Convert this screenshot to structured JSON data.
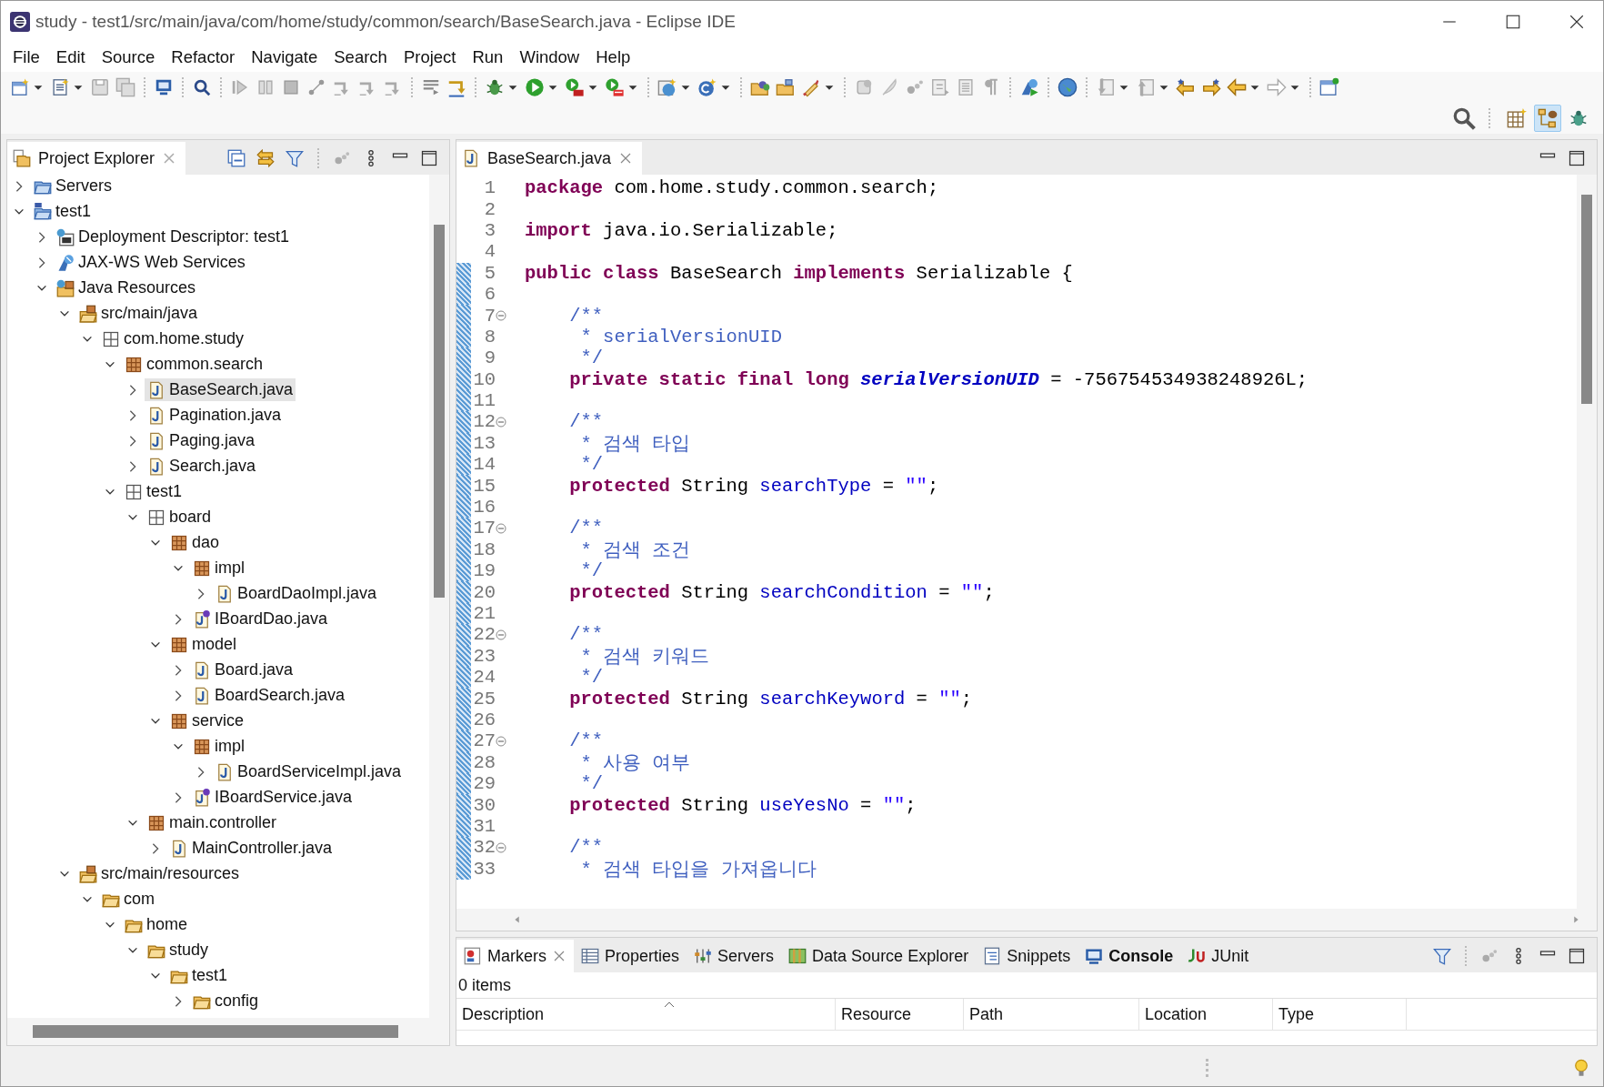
{
  "window": {
    "title": "study - test1/src/main/java/com/home/study/common/search/BaseSearch.java - Eclipse IDE"
  },
  "menu": [
    "File",
    "Edit",
    "Source",
    "Refactor",
    "Navigate",
    "Search",
    "Project",
    "Run",
    "Window",
    "Help"
  ],
  "perspectives": [
    {
      "selected": false
    },
    {
      "selected": true
    },
    {
      "selected": false
    }
  ],
  "explorer": {
    "title": "Project Explorer",
    "tree": [
      {
        "label": "Servers",
        "kind": "servers",
        "expanded": false,
        "selected": false
      },
      {
        "label": "test1",
        "kind": "project",
        "expanded": true,
        "selected": false,
        "children": [
          {
            "label": "Deployment Descriptor: test1",
            "kind": "descriptor",
            "expanded": false,
            "selected": false
          },
          {
            "label": "JAX-WS Web Services",
            "kind": "webservices",
            "expanded": false,
            "selected": false
          },
          {
            "label": "Java Resources",
            "kind": "javares",
            "expanded": true,
            "selected": false,
            "children": [
              {
                "label": "src/main/java",
                "kind": "srcfolder",
                "expanded": true,
                "selected": false,
                "children": [
                  {
                    "label": "com.home.study",
                    "kind": "emptypackage",
                    "expanded": true,
                    "selected": false,
                    "children": [
                      {
                        "label": "common.search",
                        "kind": "package",
                        "expanded": true,
                        "selected": false,
                        "children": [
                          {
                            "label": "BaseSearch.java",
                            "kind": "java",
                            "expanded": false,
                            "selected": true
                          },
                          {
                            "label": "Pagination.java",
                            "kind": "java",
                            "expanded": false,
                            "selected": false
                          },
                          {
                            "label": "Paging.java",
                            "kind": "java",
                            "expanded": false,
                            "selected": false
                          },
                          {
                            "label": "Search.java",
                            "kind": "java",
                            "expanded": false,
                            "selected": false
                          }
                        ]
                      },
                      {
                        "label": "test1",
                        "kind": "emptypackage",
                        "expanded": true,
                        "selected": false,
                        "children": [
                          {
                            "label": "board",
                            "kind": "emptypackage",
                            "expanded": true,
                            "selected": false,
                            "children": [
                              {
                                "label": "dao",
                                "kind": "package",
                                "expanded": true,
                                "selected": false,
                                "children": [
                                  {
                                    "label": "impl",
                                    "kind": "package",
                                    "expanded": true,
                                    "selected": false,
                                    "children": [
                                      {
                                        "label": "BoardDaoImpl.java",
                                        "kind": "java",
                                        "expanded": false,
                                        "selected": false
                                      }
                                    ]
                                  },
                                  {
                                    "label": "IBoardDao.java",
                                    "kind": "interface",
                                    "expanded": false,
                                    "selected": false
                                  }
                                ]
                              },
                              {
                                "label": "model",
                                "kind": "package",
                                "expanded": true,
                                "selected": false,
                                "children": [
                                  {
                                    "label": "Board.java",
                                    "kind": "java",
                                    "expanded": false,
                                    "selected": false
                                  },
                                  {
                                    "label": "BoardSearch.java",
                                    "kind": "java",
                                    "expanded": false,
                                    "selected": false
                                  }
                                ]
                              },
                              {
                                "label": "service",
                                "kind": "package",
                                "expanded": true,
                                "selected": false,
                                "children": [
                                  {
                                    "label": "impl",
                                    "kind": "package",
                                    "expanded": true,
                                    "selected": false,
                                    "children": [
                                      {
                                        "label": "BoardServiceImpl.java",
                                        "kind": "java",
                                        "expanded": false,
                                        "selected": false
                                      }
                                    ]
                                  },
                                  {
                                    "label": "IBoardService.java",
                                    "kind": "interface",
                                    "expanded": false,
                                    "selected": false
                                  }
                                ]
                              }
                            ]
                          },
                          {
                            "label": "main.controller",
                            "kind": "package",
                            "expanded": true,
                            "selected": false,
                            "children": [
                              {
                                "label": "MainController.java",
                                "kind": "java",
                                "expanded": false,
                                "selected": false
                              }
                            ]
                          }
                        ]
                      }
                    ]
                  }
                ]
              },
              {
                "label": "src/main/resources",
                "kind": "srcfolder",
                "expanded": true,
                "selected": false,
                "children": [
                  {
                    "label": "com",
                    "kind": "folder",
                    "expanded": true,
                    "selected": false,
                    "children": [
                      {
                        "label": "home",
                        "kind": "folder",
                        "expanded": true,
                        "selected": false,
                        "children": [
                          {
                            "label": "study",
                            "kind": "folder",
                            "expanded": true,
                            "selected": false,
                            "children": [
                              {
                                "label": "test1",
                                "kind": "folder",
                                "expanded": true,
                                "selected": false,
                                "children": [
                                  {
                                    "label": "config",
                                    "kind": "folder",
                                    "expanded": false,
                                    "selected": false
                                  }
                                ]
                              }
                            ]
                          }
                        ]
                      }
                    ]
                  }
                ]
              }
            ]
          }
        ]
      }
    ]
  },
  "editor": {
    "tabs": [
      {
        "label": "BaseSearch.java",
        "selected": true
      }
    ],
    "lines": [
      {
        "no": "1",
        "changed": false,
        "fold": false,
        "tokens": [
          {
            "kind": "kw",
            "text": "package"
          },
          {
            "kind": "plain",
            "text": " com.home.study.common.search;"
          }
        ]
      },
      {
        "no": "2",
        "changed": false,
        "fold": false
      },
      {
        "no": "3",
        "changed": false,
        "fold": false,
        "tokens": [
          {
            "kind": "kw",
            "text": "import"
          },
          {
            "kind": "plain",
            "text": " java.io.Serializable;"
          }
        ]
      },
      {
        "no": "4",
        "changed": false,
        "fold": false
      },
      {
        "no": "5",
        "changed": true,
        "fold": false,
        "tokens": [
          {
            "kind": "kw",
            "text": "public class"
          },
          {
            "kind": "plain",
            "text": " BaseSearch "
          },
          {
            "kind": "kw",
            "text": "implements"
          },
          {
            "kind": "plain",
            "text": " Serializable {"
          }
        ]
      },
      {
        "no": "6",
        "changed": true,
        "fold": false
      },
      {
        "no": "7",
        "changed": true,
        "fold": true,
        "tokens": [
          {
            "kind": "comment",
            "text": "    /**"
          }
        ]
      },
      {
        "no": "8",
        "changed": true,
        "fold": false,
        "tokens": [
          {
            "kind": "comment",
            "text": "     * serialVersionUID"
          }
        ]
      },
      {
        "no": "9",
        "changed": true,
        "fold": false,
        "tokens": [
          {
            "kind": "comment",
            "text": "     */"
          }
        ]
      },
      {
        "no": "10",
        "changed": true,
        "fold": false,
        "tokens": [
          {
            "kind": "kw",
            "text": "    private static final long"
          },
          {
            "kind": "constant",
            "text": " serialVersionUID"
          },
          {
            "kind": "plain",
            "text": " = -756754534938248926L;"
          }
        ]
      },
      {
        "no": "11",
        "changed": true,
        "fold": false
      },
      {
        "no": "12",
        "changed": true,
        "fold": true,
        "tokens": [
          {
            "kind": "comment",
            "text": "    /**"
          }
        ]
      },
      {
        "no": "13",
        "changed": true,
        "fold": false,
        "tokens": [
          {
            "kind": "comment",
            "text": "     * 검색 타입"
          }
        ]
      },
      {
        "no": "14",
        "changed": true,
        "fold": false,
        "tokens": [
          {
            "kind": "comment",
            "text": "     */"
          }
        ]
      },
      {
        "no": "15",
        "changed": true,
        "fold": false,
        "tokens": [
          {
            "kind": "kw",
            "text": "    protected"
          },
          {
            "kind": "plain",
            "text": " String "
          },
          {
            "kind": "field",
            "text": "searchType"
          },
          {
            "kind": "plain",
            "text": " = "
          },
          {
            "kind": "string",
            "text": "\"\""
          },
          {
            "kind": "plain",
            "text": ";"
          }
        ]
      },
      {
        "no": "16",
        "changed": true,
        "fold": false
      },
      {
        "no": "17",
        "changed": true,
        "fold": true,
        "tokens": [
          {
            "kind": "comment",
            "text": "    /**"
          }
        ]
      },
      {
        "no": "18",
        "changed": true,
        "fold": false,
        "tokens": [
          {
            "kind": "comment",
            "text": "     * 검색 조건"
          }
        ]
      },
      {
        "no": "19",
        "changed": true,
        "fold": false,
        "tokens": [
          {
            "kind": "comment",
            "text": "     */"
          }
        ]
      },
      {
        "no": "20",
        "changed": true,
        "fold": false,
        "tokens": [
          {
            "kind": "kw",
            "text": "    protected"
          },
          {
            "kind": "plain",
            "text": " String "
          },
          {
            "kind": "field",
            "text": "searchCondition"
          },
          {
            "kind": "plain",
            "text": " = "
          },
          {
            "kind": "string",
            "text": "\"\""
          },
          {
            "kind": "plain",
            "text": ";"
          }
        ]
      },
      {
        "no": "21",
        "changed": true,
        "fold": false
      },
      {
        "no": "22",
        "changed": true,
        "fold": true,
        "tokens": [
          {
            "kind": "comment",
            "text": "    /**"
          }
        ]
      },
      {
        "no": "23",
        "changed": true,
        "fold": false,
        "tokens": [
          {
            "kind": "comment",
            "text": "     * 검색 키워드"
          }
        ]
      },
      {
        "no": "24",
        "changed": true,
        "fold": false,
        "tokens": [
          {
            "kind": "comment",
            "text": "     */"
          }
        ]
      },
      {
        "no": "25",
        "changed": true,
        "fold": false,
        "tokens": [
          {
            "kind": "kw",
            "text": "    protected"
          },
          {
            "kind": "plain",
            "text": " String "
          },
          {
            "kind": "field",
            "text": "searchKeyword"
          },
          {
            "kind": "plain",
            "text": " = "
          },
          {
            "kind": "string",
            "text": "\"\""
          },
          {
            "kind": "plain",
            "text": ";"
          }
        ]
      },
      {
        "no": "26",
        "changed": true,
        "fold": false
      },
      {
        "no": "27",
        "changed": true,
        "fold": true,
        "tokens": [
          {
            "kind": "comment",
            "text": "    /**"
          }
        ]
      },
      {
        "no": "28",
        "changed": true,
        "fold": false,
        "tokens": [
          {
            "kind": "comment",
            "text": "     * 사용 여부"
          }
        ]
      },
      {
        "no": "29",
        "changed": true,
        "fold": false,
        "tokens": [
          {
            "kind": "comment",
            "text": "     */"
          }
        ]
      },
      {
        "no": "30",
        "changed": true,
        "fold": false,
        "tokens": [
          {
            "kind": "kw",
            "text": "    protected"
          },
          {
            "kind": "plain",
            "text": " String "
          },
          {
            "kind": "field",
            "text": "useYesNo"
          },
          {
            "kind": "plain",
            "text": " = "
          },
          {
            "kind": "string",
            "text": "\"\""
          },
          {
            "kind": "plain",
            "text": ";"
          }
        ]
      },
      {
        "no": "31",
        "changed": true,
        "fold": false
      },
      {
        "no": "32",
        "changed": true,
        "fold": true,
        "tokens": [
          {
            "kind": "comment",
            "text": "    /**"
          }
        ]
      },
      {
        "no": "33",
        "changed": true,
        "fold": false,
        "tokens": [
          {
            "kind": "comment",
            "text": "     * 검색 타입을 가져옵니다"
          }
        ]
      }
    ]
  },
  "bottom": {
    "tabs": [
      {
        "label": "Markers",
        "kind": "markers",
        "selected": true,
        "bold": false
      },
      {
        "label": "Properties",
        "kind": "properties",
        "selected": false,
        "bold": false
      },
      {
        "label": "Servers",
        "kind": "servers",
        "selected": false,
        "bold": false
      },
      {
        "label": "Data Source Explorer",
        "kind": "datasource",
        "selected": false,
        "bold": false
      },
      {
        "label": "Snippets",
        "kind": "snippets",
        "selected": false,
        "bold": false
      },
      {
        "label": "Console",
        "kind": "console",
        "selected": false,
        "bold": true
      },
      {
        "label": "JUnit",
        "kind": "junit",
        "selected": false,
        "bold": false
      }
    ],
    "summary": "0 items",
    "columns": [
      "Description",
      "Resource",
      "Path",
      "Location",
      "Type"
    ]
  }
}
